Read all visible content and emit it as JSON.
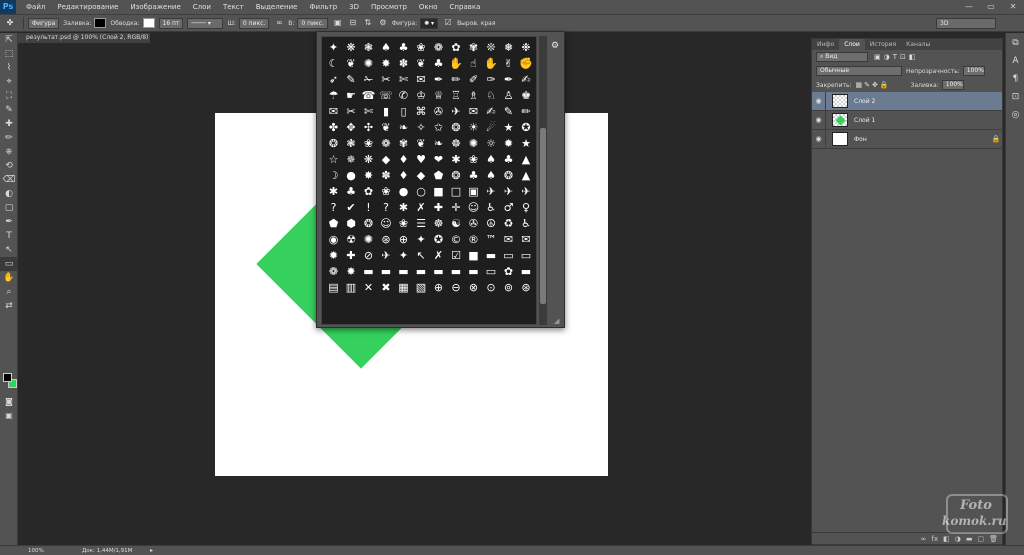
{
  "app": {
    "logo": "Ps"
  },
  "menu": [
    "Файл",
    "Редактирование",
    "Изображение",
    "Слои",
    "Текст",
    "Выделение",
    "Фильтр",
    "3D",
    "Просмотр",
    "Окно",
    "Справка"
  ],
  "window_controls": [
    "—",
    "▭",
    "✕"
  ],
  "options": {
    "mode": "Фигура",
    "fill_label": "Заливка:",
    "stroke_label": "Обводка:",
    "stroke_size": "16 пт",
    "w_label": "Ш:",
    "w_value": "0 пикс.",
    "h_label": "В:",
    "h_value": "0 пикс.",
    "shape_label": "Фигура:",
    "antialias_label": "Выров. края",
    "workspace": "3D"
  },
  "doc_tab": "результат.psd @ 100% (Слой 2, RGB/8) *",
  "shape_picker": {
    "rows": [
      "✦❋❃♠♣❀❁✿✾❊❅❉",
      "☾❦✺✸✽❦♣✋☝✋✌✊",
      "➶✎✁✂✄✉✒✏✐✑✒✍",
      "☂☛☎☏✆♔♕♖♗♘♙♚",
      "✉✂✄▮▯⌘✇✈✉✍✎✏",
      "✤✥✣❦❧✧✩❂☀☄★✪",
      "❂❃❀❁✾❦❧☸✺☼✹★",
      "☆✵❋◆♦♥❤✱❀♠♣▲",
      "☽●✸✽♦◆⬟❂♣♠❂▲",
      "✱♣✿❀●○■□▣✈✈✈",
      "?✔!?✱✗✚✛☺♿♂♀",
      "⬟⬢❂☺❀☰☸☯✇☮♻♿",
      "◉☢✺⊛⊕✦✪©®™✉✉",
      "✹✚⊘✈✦↖✗☑■▬▭▭",
      "❁✸▬▬▬▬▬▬▬▭✿▬",
      "▤▥✕✖▦▧⊕⊖⊗⊙⊚⊛"
    ],
    "gear_icon": "gear-icon",
    "grip": "◢"
  },
  "tools": [
    "⇱",
    "⬚",
    "⌇",
    "⌖",
    "⛶",
    "✎",
    "✚",
    "✏",
    "⎈",
    "⟲",
    "⌫",
    "◐",
    "▢",
    "✒",
    "T",
    "↖",
    "▭",
    "✋",
    "⌕",
    "⇄"
  ],
  "panel": {
    "tabs": [
      "Инфо",
      "Слои",
      "История",
      "Каналы"
    ],
    "active_tab": "Слои",
    "kind_filter": "Вид",
    "blend_mode": "Обычные",
    "opacity_label": "Непрозрачность:",
    "opacity_value": "100%",
    "lock_label": "Закрепить:",
    "fill_label": "Заливка:",
    "fill_value": "100%",
    "layers": [
      {
        "name": "Слой 2",
        "selected": true
      },
      {
        "name": "Слой 1",
        "selected": false
      },
      {
        "name": "Фон",
        "selected": false,
        "locked": true
      }
    ],
    "bottom_icons": [
      "∞",
      "fx",
      "◧",
      "◑",
      "▬",
      "▢",
      "🗑"
    ]
  },
  "status": {
    "zoom": "100%",
    "doc_info": "Док: 1,44M/1,91M"
  },
  "watermark": {
    "line1": "Foto",
    "line2": "komok.ru"
  },
  "colors": {
    "accent_green": "#36d15c",
    "ui_panel": "#535353",
    "ui_dark": "#282828",
    "selection": "#6b7b92"
  }
}
